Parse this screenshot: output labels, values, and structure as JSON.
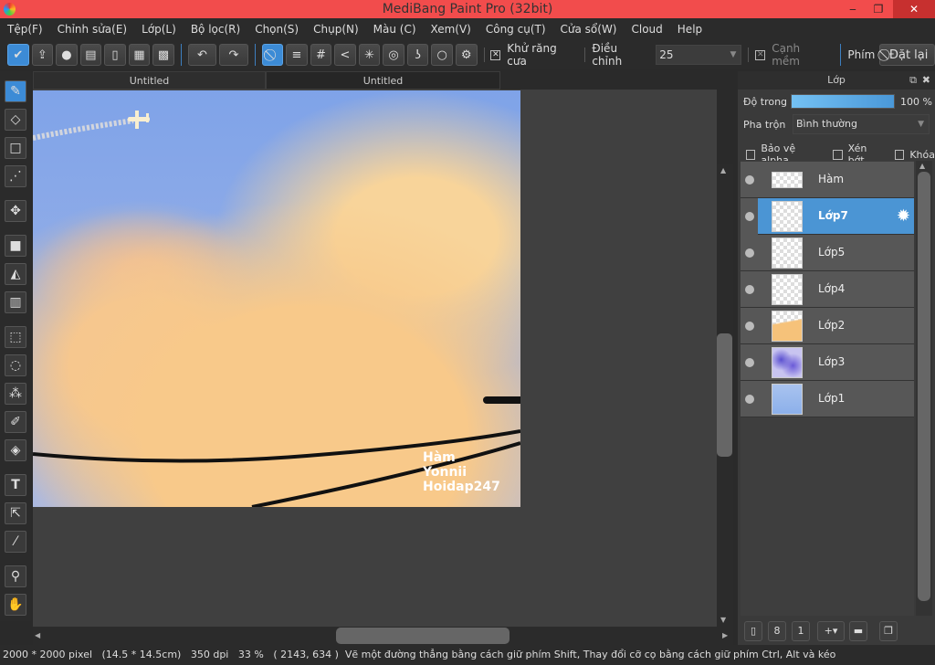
{
  "window": {
    "title": "MediBang Paint Pro (32bit)",
    "minimize": "‒",
    "maximize": "❐",
    "close": "✕"
  },
  "menu": [
    "Tệp(F)",
    "Chỉnh sửa(E)",
    "Lớp(L)",
    "Bộ lọc(R)",
    "Chọn(S)",
    "Chụp(N)",
    "Màu (C)",
    "Xem(V)",
    "Công cụ(T)",
    "Cửa sổ(W)",
    "Cloud",
    "Help"
  ],
  "toolbar": {
    "antialias_label": "Khử răng cưa",
    "antialias_checked": true,
    "adjust_label": "Điều chỉnh",
    "adjust_value": "25",
    "soft_edge_label": "Cạnh mềm",
    "key_label": "Phím",
    "reset_label": "Đặt lại"
  },
  "tabs": [
    "Untitled",
    "Untitled"
  ],
  "canvas": {
    "watermark": [
      "Hàm",
      "Yonnii",
      "Hoidap247"
    ]
  },
  "panel": {
    "title": "Lớp",
    "opacity_label": "Độ trong",
    "opacity_value": "100 %",
    "opacity": 100,
    "blend_label": "Pha trộn",
    "blend_value": "Bình thường",
    "protect_alpha": "Bảo vệ alpha",
    "clip": "Xén bớt",
    "lock": "Khóa",
    "layers": [
      {
        "name": "Hàm"
      },
      {
        "name": "Lớp7",
        "selected": true
      },
      {
        "name": "Lớp5"
      },
      {
        "name": "Lớp4"
      },
      {
        "name": "Lớp2"
      },
      {
        "name": "Lớp3"
      },
      {
        "name": "Lớp1"
      }
    ]
  },
  "status": {
    "size": "2000 * 2000 pixel",
    "physical": "(14.5 * 14.5cm)",
    "dpi": "350 dpi",
    "zoom": "33 %",
    "coords": "( 2143, 634 )",
    "hint": "Vẽ một đường thẳng bằng cách giữ phím Shift, Thay đổi cỡ cọ bằng cách giữ phím Ctrl, Alt và kéo"
  },
  "colors": {
    "titlebar": "#f24c4c",
    "accent": "#3c8bd6"
  }
}
